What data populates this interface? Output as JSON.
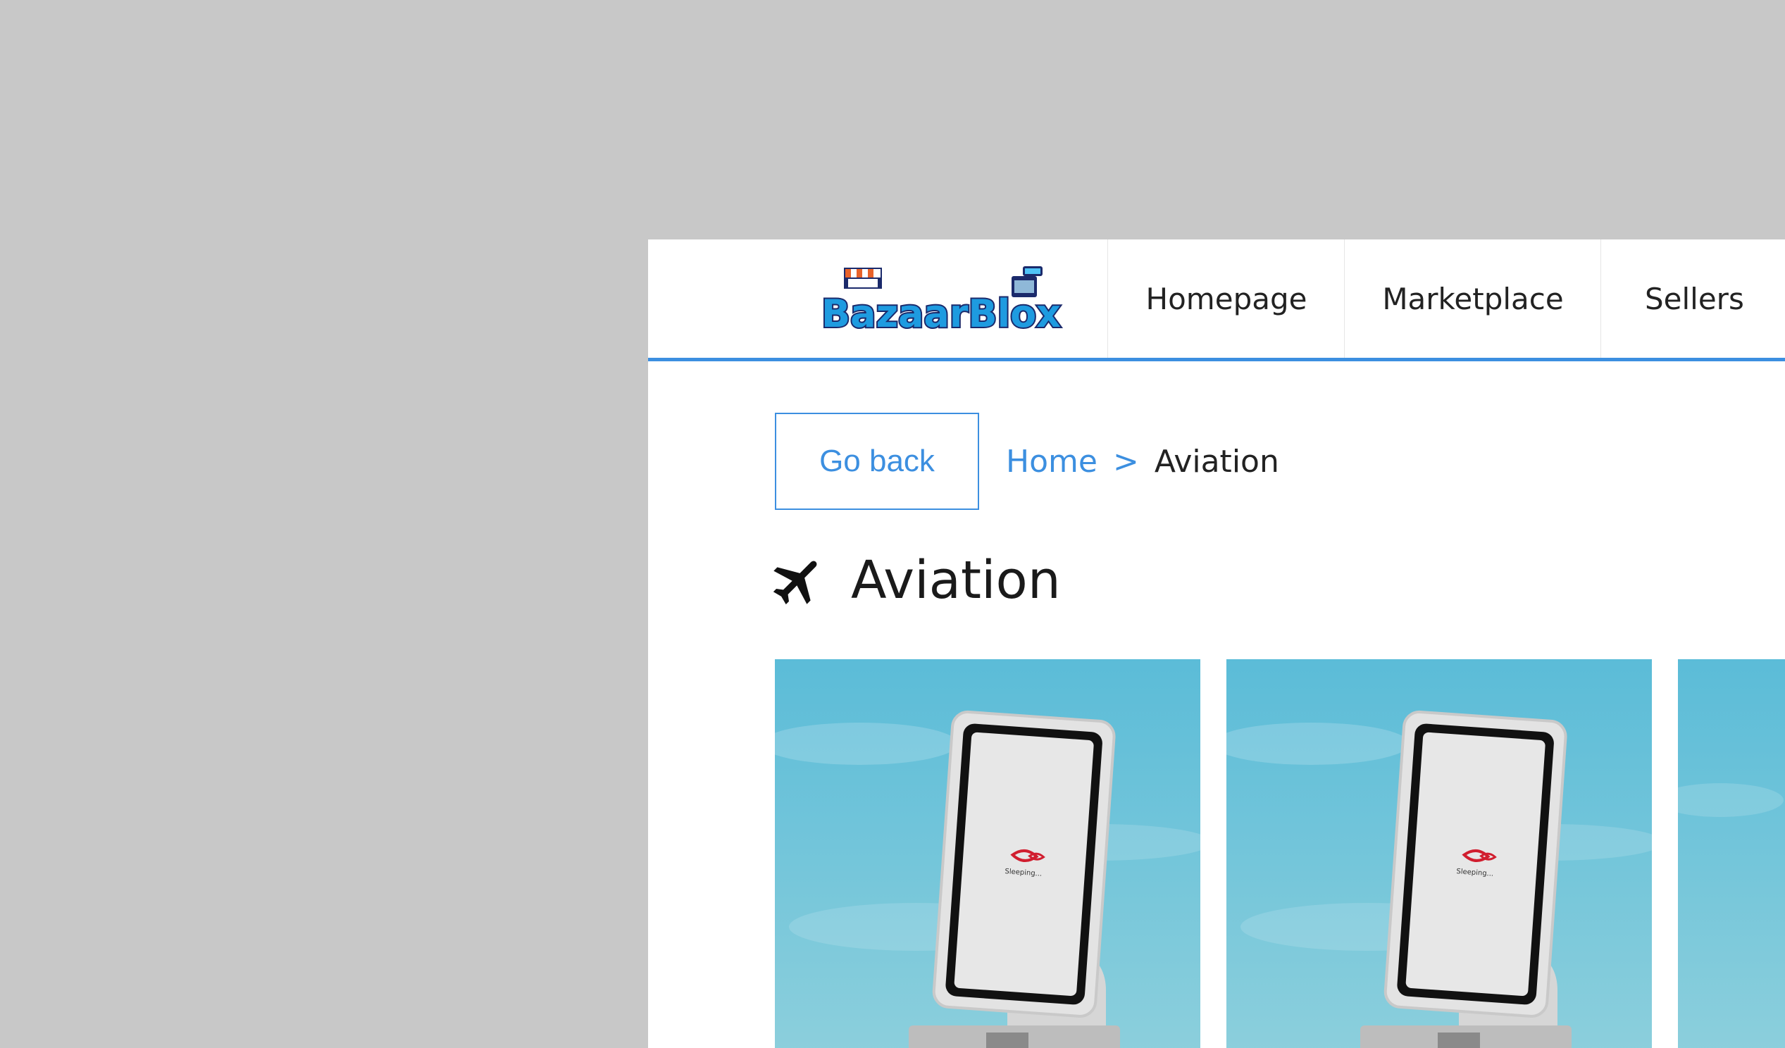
{
  "brand": {
    "name": "BazaarBlox",
    "colors": {
      "accent": "#3c8fe0",
      "logo_blue": "#1e88d6",
      "logo_navy": "#1b2a6b"
    }
  },
  "nav": {
    "items": [
      {
        "label": "Homepage"
      },
      {
        "label": "Marketplace"
      },
      {
        "label": "Sellers"
      }
    ]
  },
  "actions": {
    "go_back_label": "Go back"
  },
  "breadcrumb": {
    "home_label": "Home",
    "separator": ">",
    "current_label": "Aviation"
  },
  "page": {
    "title": "Aviation",
    "icon": "airplane-icon"
  },
  "products": [
    {
      "image": "kiosk-image",
      "screen_text": "Sleeping..."
    },
    {
      "image": "kiosk-image",
      "screen_text": "Sleeping..."
    },
    {
      "image": "kiosk-image"
    }
  ]
}
